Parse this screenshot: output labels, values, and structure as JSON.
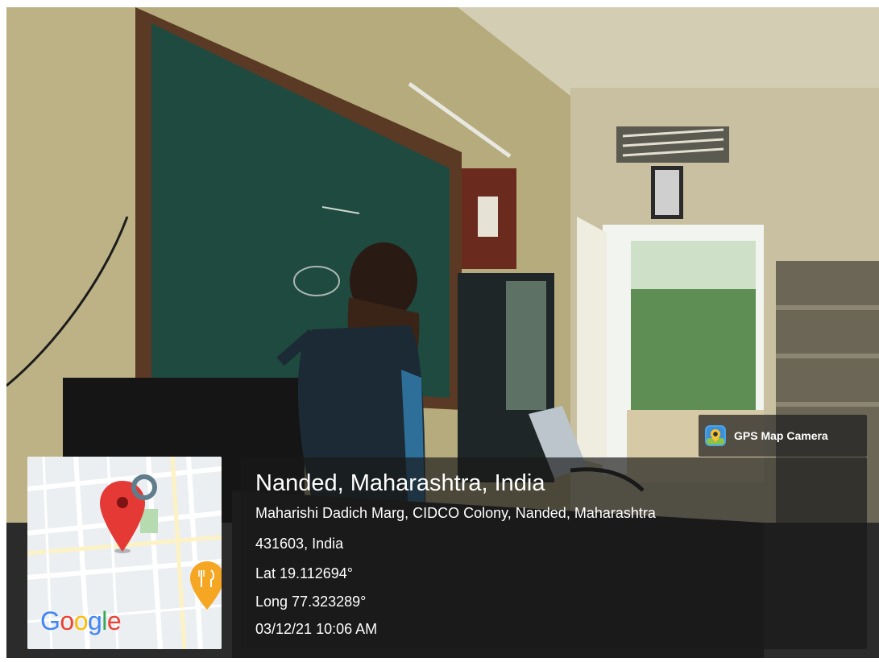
{
  "badge": {
    "label": "GPS Map Camera",
    "icon": "gps-map-camera-icon"
  },
  "map": {
    "logo_letters": [
      "G",
      "o",
      "o",
      "g",
      "l",
      "e"
    ],
    "pin_icon": "location-pin-icon",
    "poi_icon": "restaurant-icon"
  },
  "location": {
    "title": "Nanded, Maharashtra, India",
    "address_line1": "Maharishi Dadich Marg, CIDCO Colony, Nanded, Maharashtra",
    "address_line2": "431603, India",
    "lat": "Lat 19.112694°",
    "long": "Long 77.323289°",
    "datetime": "03/12/21 10:06 AM"
  },
  "colors": {
    "pin": "#e53935",
    "poi": "#f5a623",
    "panel": "#191919",
    "chalkboard": "#1f4a40"
  }
}
